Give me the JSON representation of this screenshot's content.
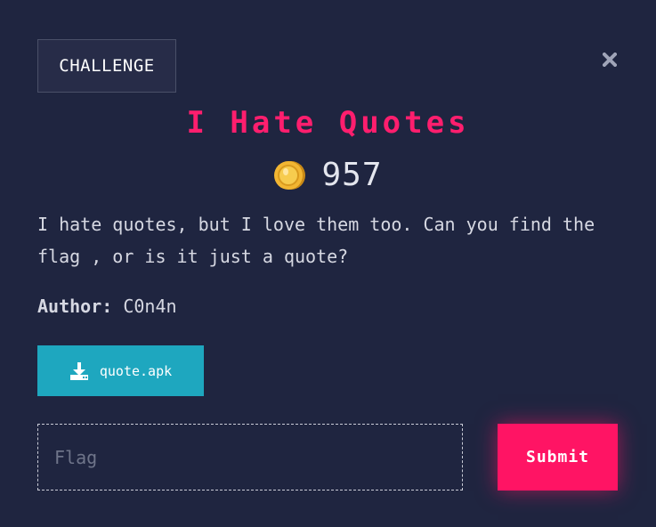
{
  "header": {
    "tab_label": "CHALLENGE",
    "close_icon": "close-icon"
  },
  "challenge": {
    "title": "I Hate Quotes",
    "points": "957",
    "coin_icon": "coin-icon",
    "description": "I hate quotes, but I love them too. Can you find the flag , or is it just a quote?",
    "author_label": "Author:",
    "author_name": "C0n4n"
  },
  "attachment": {
    "file_name": "quote.apk",
    "icon": "download-icon"
  },
  "form": {
    "flag_placeholder": "Flag",
    "flag_value": "",
    "submit_label": "Submit"
  },
  "colors": {
    "background": "#1f2540",
    "title": "#ff1e6e",
    "download_button": "#1ea7bf",
    "submit_button": "#ff1464",
    "coin": "#f2b632"
  }
}
